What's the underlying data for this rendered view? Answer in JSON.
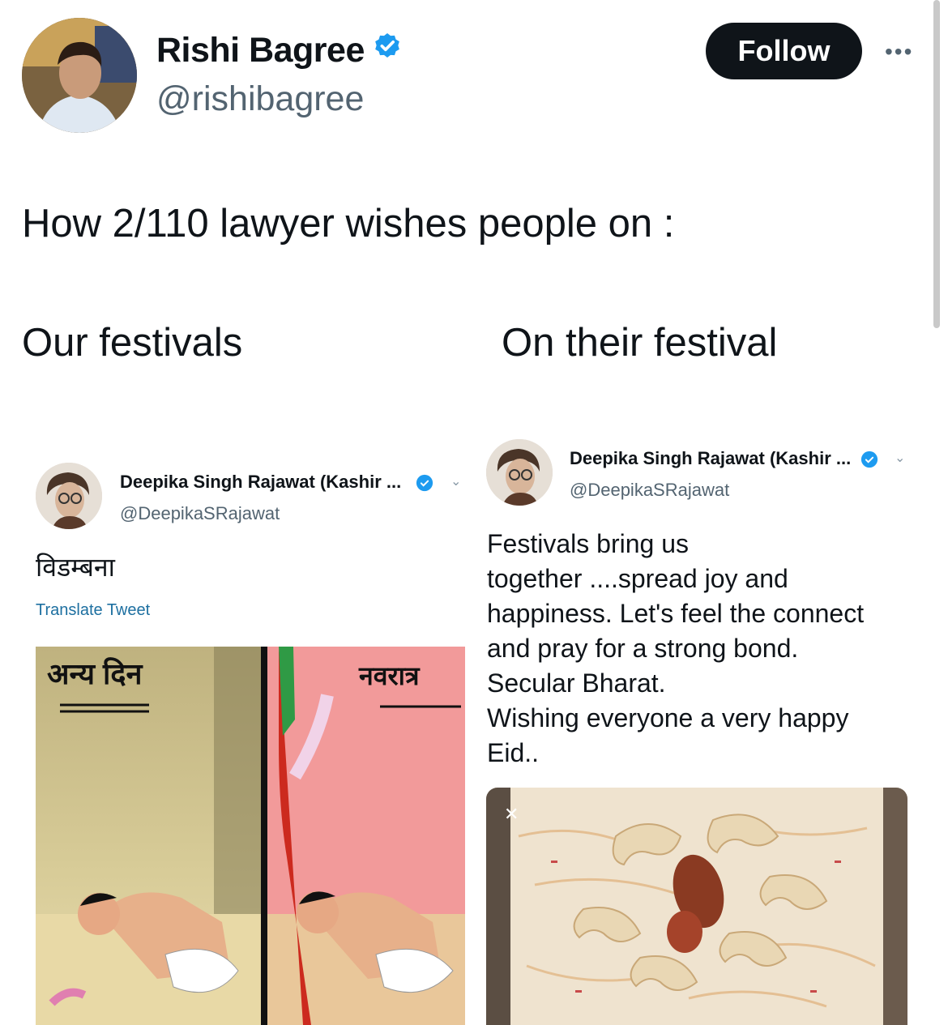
{
  "author": {
    "name": "Rishi Bagree",
    "handle": "@rishibagree",
    "follow_label": "Follow",
    "more_label": "•••"
  },
  "tweet": {
    "text": "How 2/110 lawyer wishes people on :",
    "left_caption": "Our festivals",
    "right_caption": "On their festival"
  },
  "left_embed": {
    "name": "Deepika Singh Rajawat (Kashir ...",
    "handle": "@DeepikaSRajawat",
    "text": "विडम्बना",
    "translate_label": "Translate Tweet",
    "panel_left_label": "अन्य दिन",
    "panel_right_label": "नवरात्र"
  },
  "right_embed": {
    "name": "Deepika Singh Rajawat (Kashir ...",
    "handle": "@DeepikaSRajawat",
    "lines": [
      "Festivals bring us",
      "together ....spread joy and",
      "happiness.  Let's feel the connect",
      "and pray for a strong bond.",
      "Secular Bharat.",
      "Wishing everyone a very happy",
      "Eid.."
    ]
  },
  "colors": {
    "verified_blue": "#1d9bf0",
    "follow_bg": "#0f1419",
    "secondary_text": "#536471",
    "cartoon_left_bg": "#c9b98a",
    "cartoon_right_bg": "#f29a9a"
  }
}
